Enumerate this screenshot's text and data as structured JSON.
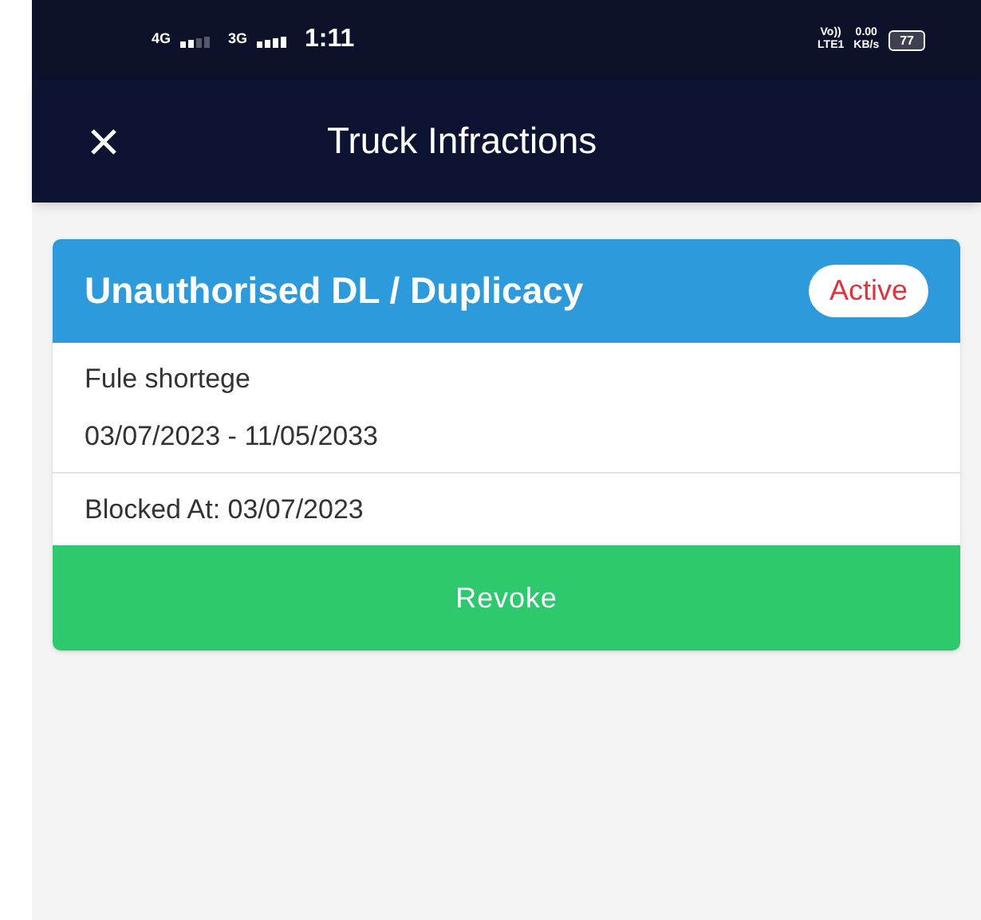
{
  "status_bar": {
    "network_1": "4G",
    "network_2": "3G",
    "time": "1:11",
    "volte": "Vo))",
    "lte": "LTE1",
    "speed": "0.00",
    "speed_unit": "KB/s",
    "battery": "77"
  },
  "header": {
    "title": "Truck Infractions"
  },
  "cards": [
    {
      "title": "Unauthorised DL / Duplicacy",
      "status": "Active",
      "reason": "Fule shortege",
      "period": "03/07/2023 - 11/05/2033",
      "blocked_at": "Blocked At: 03/07/2023",
      "action": "Revoke"
    }
  ]
}
